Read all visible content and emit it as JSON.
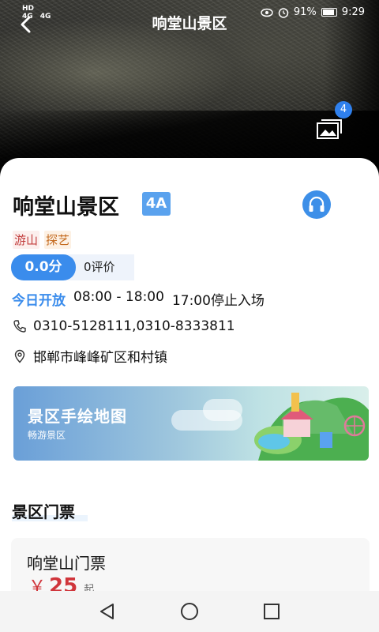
{
  "status_bar": {
    "left_labels": [
      "HD",
      "4G",
      "4G"
    ],
    "battery": "91%",
    "time": "9:29"
  },
  "header": {
    "title": "响堂山景区"
  },
  "gallery": {
    "count": "4"
  },
  "spot": {
    "name": "响堂山景区",
    "level": "4A",
    "tags": [
      "游山",
      "探艺"
    ],
    "score": "0.0分",
    "reviews": "0评价",
    "open_label": "今日开放",
    "hours": "08:00 - 18:00",
    "last_entry": "17:00停止入场",
    "phone": "0310-5128111,0310-8333811",
    "address": "邯郸市峰峰矿区和村镇"
  },
  "map_banner": {
    "title": "景区手绘地图",
    "subtitle": "畅游景区"
  },
  "tickets": {
    "section_title": "景区门票",
    "items": [
      {
        "name": "响堂山门票",
        "currency": "￥",
        "price": "25",
        "unit": "起"
      }
    ]
  },
  "colors": {
    "accent": "#3a8cec",
    "price": "#d0353b"
  }
}
